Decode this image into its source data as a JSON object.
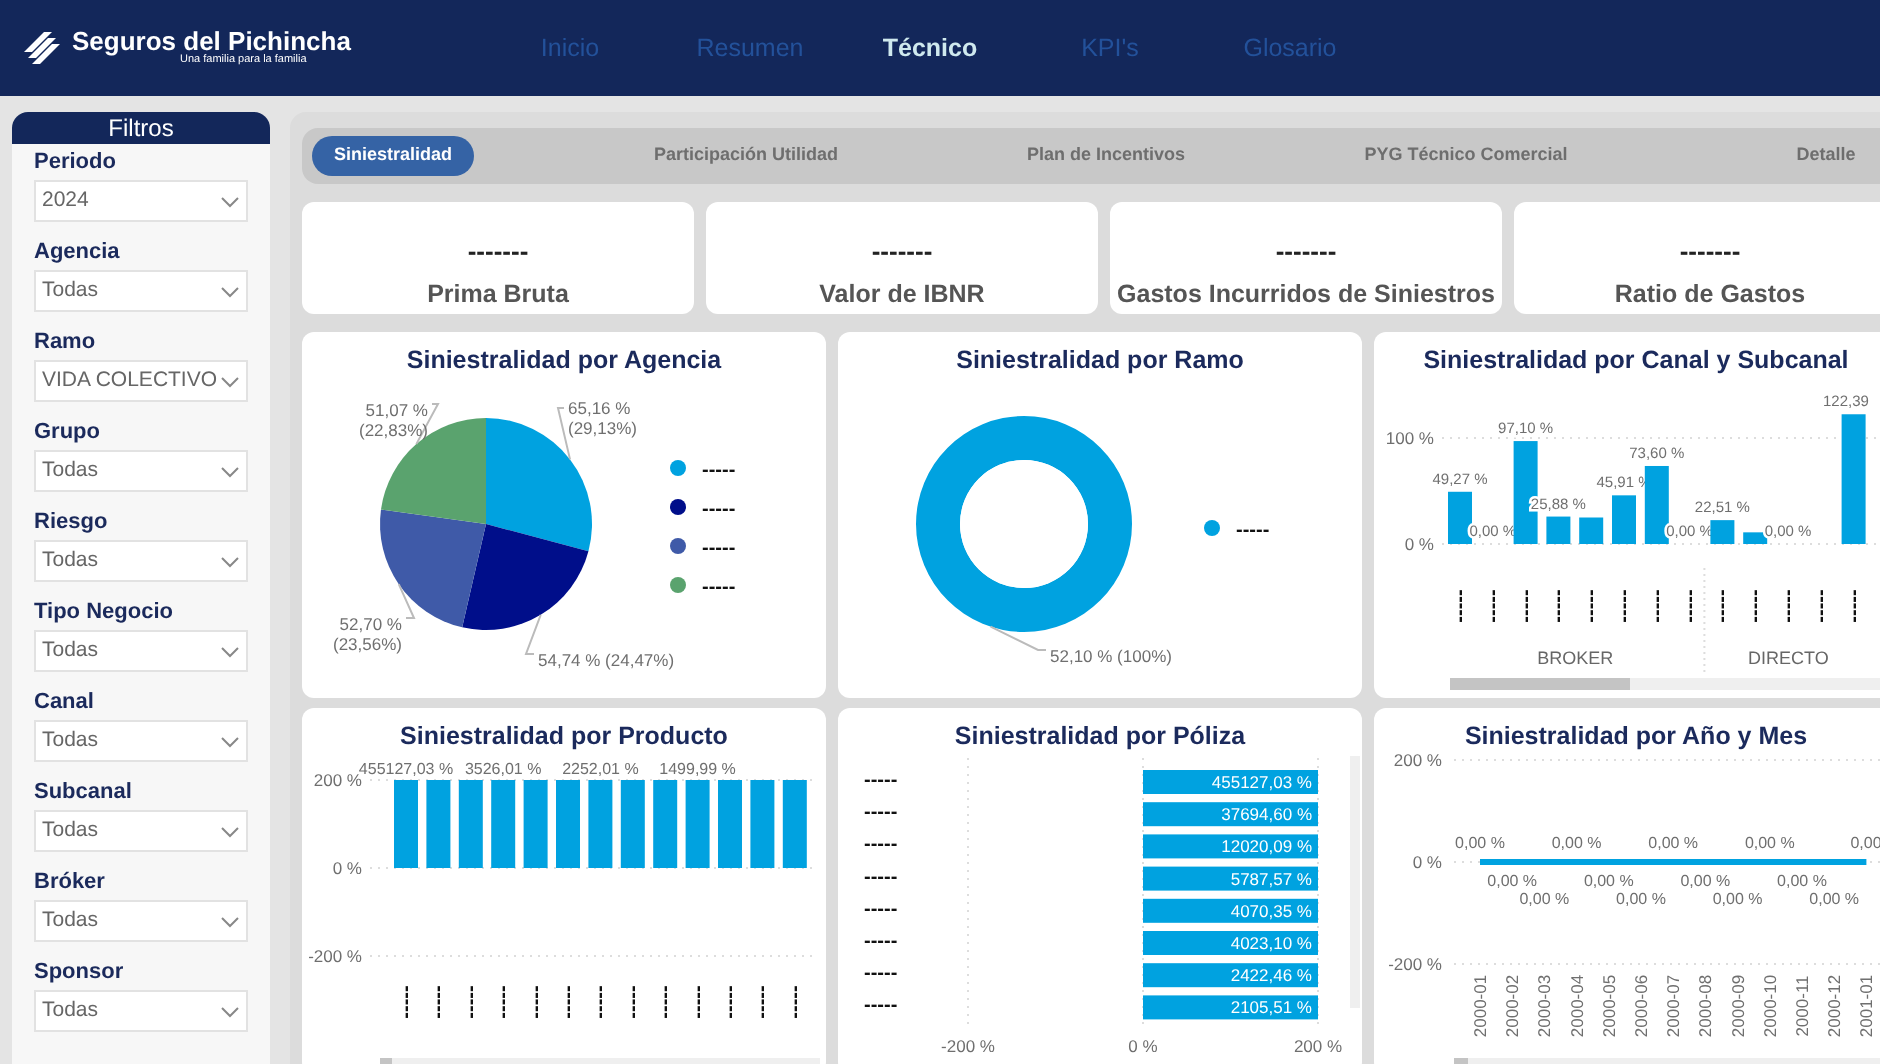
{
  "header": {
    "logo_title": "Seguros del Pichincha",
    "logo_tagline": "Una familia para la familia",
    "nav": [
      {
        "label": "Inicio",
        "selected": false
      },
      {
        "label": "Resumen",
        "selected": false
      },
      {
        "label": "Técnico",
        "selected": true
      },
      {
        "label": "KPI's",
        "selected": false
      },
      {
        "label": "Glosario",
        "selected": false
      }
    ]
  },
  "filters": {
    "title": "Filtros",
    "items": [
      {
        "label": "Periodo",
        "value": "2024"
      },
      {
        "label": "Agencia",
        "value": "Todas"
      },
      {
        "label": "Ramo",
        "value": "VIDA COLECTIVO"
      },
      {
        "label": "Grupo",
        "value": "Todas"
      },
      {
        "label": "Riesgo",
        "value": "Todas"
      },
      {
        "label": "Tipo Negocio",
        "value": "Todas"
      },
      {
        "label": "Canal",
        "value": "Todas"
      },
      {
        "label": "Subcanal",
        "value": "Todas"
      },
      {
        "label": "Bróker",
        "value": "Todas"
      },
      {
        "label": "Sponsor",
        "value": "Todas"
      }
    ]
  },
  "tabs": [
    {
      "label": "Siniestralidad",
      "selected": true
    },
    {
      "label": "Participación Utilidad",
      "selected": false
    },
    {
      "label": "Plan de Incentivos",
      "selected": false
    },
    {
      "label": "PYG Técnico Comercial",
      "selected": false
    },
    {
      "label": "Detalle",
      "selected": false
    }
  ],
  "kpis": [
    {
      "value": "-------",
      "label": "Prima Bruta"
    },
    {
      "value": "-------",
      "label": "Valor de IBNR"
    },
    {
      "value": "-------",
      "label": "Gastos Incurridos de Siniestros"
    },
    {
      "value": "-------",
      "label": "Ratio de Gastos"
    }
  ],
  "charts": [
    {
      "title": "Siniestralidad por Agencia",
      "legend": [
        {
          "color": "#00a2e0"
        },
        {
          "color": "#000e8a"
        },
        {
          "color": "#3f5aa8"
        },
        {
          "color": "#5aa36e"
        }
      ],
      "chart_data": {
        "type": "pie",
        "categories": [
          "-----",
          "-----",
          "-----",
          "-----"
        ],
        "values": [
          29.13,
          24.47,
          23.56,
          22.83
        ],
        "value_labels": [
          "65,16 %\n(29,13%)",
          "54,74 % (24,47%)",
          "52,70 %\n(23,56%)",
          "51,07 %\n(22,83%)"
        ]
      }
    },
    {
      "title": "Siniestralidad por Ramo",
      "legend": [
        {
          "color": "#00a2e0"
        }
      ],
      "chart_data": {
        "type": "donut",
        "categories": [
          "-----"
        ],
        "values": [
          100
        ],
        "value_labels": [
          "52,10 % (100%)"
        ]
      }
    },
    {
      "title": "Siniestralidad por Canal y Subcanal",
      "x_groups": [
        "BROKER",
        "DIRECTO"
      ],
      "chart_data": {
        "type": "bar",
        "categories": [
          "-----",
          "-----",
          "-----",
          "-----",
          "-----",
          "-----",
          "-----",
          "-----",
          "-----",
          "-----",
          "-----",
          "-----",
          "-----"
        ],
        "values": [
          49.27,
          0,
          97.1,
          25.88,
          25,
          45.91,
          73.6,
          0,
          22.51,
          11,
          0,
          0,
          122.39
        ],
        "ylim": [
          0,
          125
        ],
        "yticks": [
          {
            "value": 0,
            "label": "0 %"
          },
          {
            "value": 100,
            "label": "100 %"
          }
        ],
        "value_labels": [
          "49,27 %",
          "0,00 %",
          "97,10 %",
          "25,88 %",
          null,
          "45,91 %",
          "73,60 %",
          "0,00 %",
          "22,51 %",
          null,
          "0,00 %",
          null,
          "122,39"
        ]
      }
    },
    {
      "title": "Siniestralidad por Producto",
      "chart_data": {
        "type": "bar",
        "categories": [
          "-----",
          "-----",
          "-----",
          "-----",
          "-----",
          "-----",
          "-----",
          "-----",
          "-----",
          "-----",
          "-----",
          "-----",
          "-----"
        ],
        "values": [
          200,
          200,
          200,
          200,
          200,
          200,
          200,
          200,
          200,
          200,
          200,
          200,
          200
        ],
        "ylim": [
          -200,
          200
        ],
        "yticks": [
          {
            "value": -200,
            "label": "-200 %"
          },
          {
            "value": 0,
            "label": "0 %"
          },
          {
            "value": 200,
            "label": "200 %"
          }
        ],
        "annotations": [
          "455127,03 %",
          "3526,01 %",
          "2252,01 %",
          "1499,99 %"
        ]
      }
    },
    {
      "title": "Siniestralidad por Póliza",
      "chart_data": {
        "type": "bar",
        "orientation": "horizontal",
        "categories": [
          "-----",
          "-----",
          "-----",
          "-----",
          "-----",
          "-----",
          "-----",
          "-----"
        ],
        "values": [
          200,
          200,
          200,
          200,
          200,
          200,
          200,
          200
        ],
        "xlim": [
          -200,
          200
        ],
        "xticks": [
          {
            "value": -200,
            "label": "-200 %"
          },
          {
            "value": 0,
            "label": "0 %"
          },
          {
            "value": 200,
            "label": "200 %"
          }
        ],
        "annotations": [
          "455127,03 %",
          "37694,60 %",
          "12020,09 %",
          "5787,57 %",
          "4070,35 %",
          "4023,10 %",
          "2422,46 %",
          "2105,51 %"
        ]
      }
    },
    {
      "title": "Siniestralidad por Año y Mes",
      "chart_data": {
        "type": "line",
        "categories": [
          "2000-01",
          "2000-02",
          "2000-03",
          "2000-04",
          "2000-05",
          "2000-06",
          "2000-07",
          "2000-08",
          "2000-09",
          "2000-10",
          "2000-11",
          "2000-12",
          "2001-01"
        ],
        "values": [
          0,
          0,
          0,
          0,
          0,
          0,
          0,
          0,
          0,
          0,
          0,
          0,
          0
        ],
        "ylim": [
          -200,
          200
        ],
        "yticks": [
          {
            "value": -200,
            "label": "-200 %"
          },
          {
            "value": 0,
            "label": "0 %"
          },
          {
            "value": 200,
            "label": "200 %"
          }
        ],
        "value_labels": [
          "0,00 %",
          "0,00 %",
          "0,00 %",
          "0,00 %",
          "0,00 %",
          "0,00 %",
          "0,00 %",
          "0,00 %",
          "0,00 %",
          "0,00 %",
          "0,00 %",
          "0,00 %",
          "0,00"
        ]
      }
    }
  ]
}
